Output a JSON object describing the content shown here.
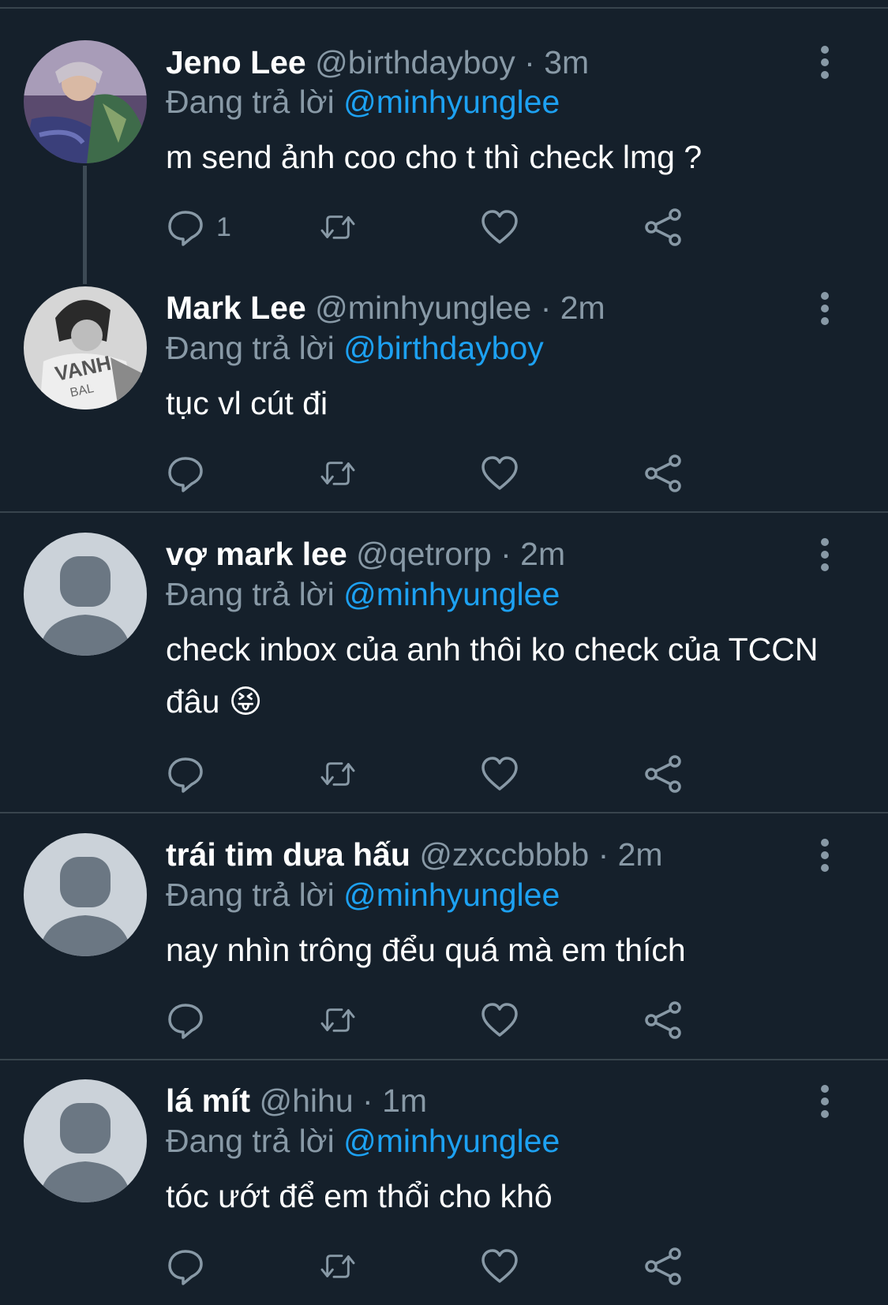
{
  "replying_prefix": "Đang trả lời",
  "dot": "·",
  "tweets": [
    {
      "name": "Jeno Lee",
      "handle": "@birthdayboy",
      "time": "3m",
      "replying_to": "@minhyunglee",
      "text": "m send ảnh coo cho t thì check lmg ?",
      "reply_count": "1",
      "avatar": "photo"
    },
    {
      "name": "Mark Lee",
      "handle": "@minhyunglee",
      "time": "2m",
      "replying_to": "@birthdayboy",
      "text": "tục vl cút đi",
      "reply_count": "",
      "avatar": "photo-bw"
    },
    {
      "name": "vợ mark lee",
      "handle": "@qetrorp",
      "time": "2m",
      "replying_to": "@minhyunglee",
      "text": "check inbox của anh thôi ko check của TCCN đâu 😝",
      "reply_count": "",
      "avatar": "default"
    },
    {
      "name": "trái tim dưa hấu",
      "handle": "@zxccbbbb",
      "time": "2m",
      "replying_to": "@minhyunglee",
      "text": "nay nhìn trông đểu quá mà em thích",
      "reply_count": "",
      "avatar": "default"
    },
    {
      "name": "lá mít",
      "handle": "@hihu",
      "time": "1m",
      "replying_to": "@minhyunglee",
      "text": "tóc ướt để em thổi cho khô",
      "reply_count": "",
      "avatar": "default"
    }
  ],
  "icons": {
    "reply": "reply-icon",
    "retweet": "retweet-icon",
    "like": "heart-icon",
    "share": "share-icon",
    "more": "more-vertical-icon"
  },
  "colors": {
    "background": "#15202b",
    "muted": "#8899a6",
    "mention": "#1da1f2",
    "divider": "#38444d"
  }
}
